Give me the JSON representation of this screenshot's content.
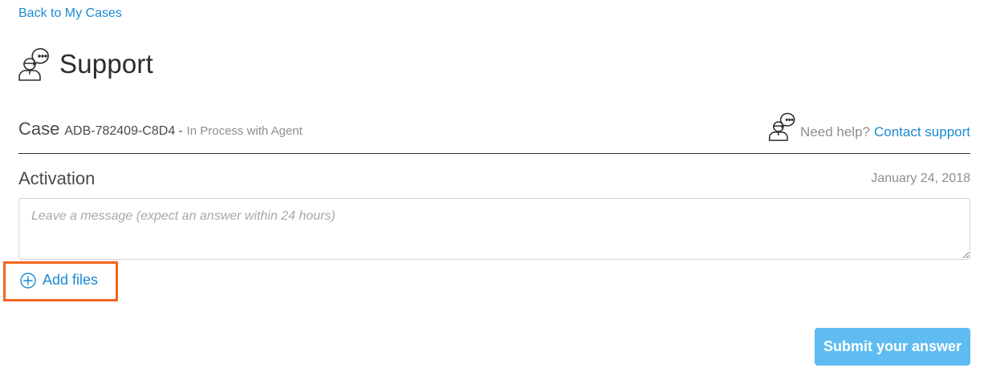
{
  "nav": {
    "back_label": "Back to My Cases"
  },
  "header": {
    "title": "Support",
    "icon": "support-agent-icon"
  },
  "case": {
    "label": "Case",
    "id": "ADB-782409-C8D4",
    "separator": "-",
    "status": "In Process with Agent"
  },
  "help": {
    "icon": "support-agent-icon",
    "prompt": "Need help?",
    "link_label": "Contact support"
  },
  "thread": {
    "topic": "Activation",
    "date": "January 24, 2018"
  },
  "composer": {
    "placeholder": "Leave a message (expect an answer within 24 hours)",
    "value": "",
    "add_files_label": "Add files",
    "add_files_icon": "plus-circle-icon",
    "submit_label": "Submit your answer"
  },
  "colors": {
    "link": "#1a8ad3",
    "submit_bg": "#5fbcf2",
    "highlight": "#f2661f",
    "divider": "#2c2c2c"
  }
}
